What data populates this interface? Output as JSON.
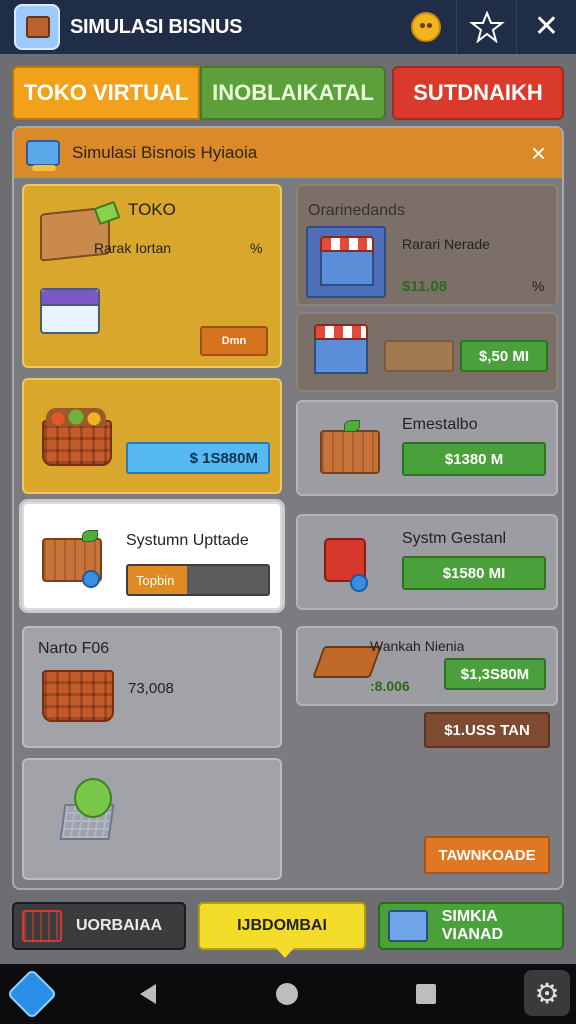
{
  "titlebar": {
    "title": "SIMULASI BISNUS"
  },
  "top_tabs": [
    "TOKO VIRTUAL",
    "INOBLAIKATAL",
    "SUTDNAIKH"
  ],
  "panel": {
    "title": "Simulasi Bisnois Hyiaoia",
    "close": "×"
  },
  "cards": {
    "toko": {
      "title": "TOKO",
      "sub": "Rarak Iortan",
      "pct": "%",
      "button": "Dmn"
    },
    "basket": {
      "price": "$ 1S880M"
    },
    "upgrade": {
      "title": "Systumn Upttade",
      "progress_label": "Topbin",
      "progress": 0.42
    },
    "cart_card": {
      "title": "Narto F06",
      "value": "73,008"
    },
    "ora": {
      "title": "Orarinedands",
      "sub": "Rarari Nerade",
      "price": "$11.08",
      "pct": "%"
    },
    "stall2": {
      "price": "$,50 MI"
    },
    "emesta": {
      "title": "Emestalbo",
      "price": "$1380 M"
    },
    "system": {
      "title": "Systm Gestanl",
      "price": "$1580 MI"
    },
    "wankah": {
      "title": "Wankah Nienia",
      "sub": ":8.006",
      "price": "$1,3S80M",
      "price2": "$1.USS TAN"
    },
    "last": {
      "button": "TAWNKOADE"
    }
  },
  "bottom": {
    "b1": "UORBAIAA",
    "b2": "IJBDOMBAI",
    "b3": "SIMKIA VIANAD"
  },
  "nav": {
    "gear": "⚙"
  }
}
